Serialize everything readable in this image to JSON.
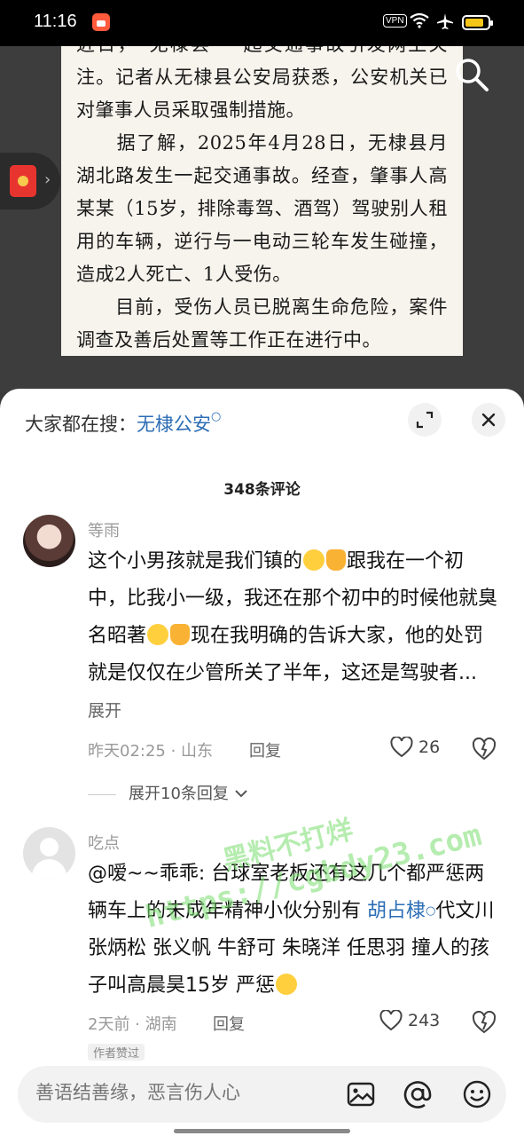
{
  "status_bar": {
    "time": "11:16",
    "vpn": "VPN"
  },
  "article": {
    "paragraphs": [
      "近日，“无棣县”一起交通事故引发网上关注。记者从无棣县公安局获悉，公安机关已对肇事人员采取强制措施。",
      "　　据了解，2025年4月28日，无棣县月湖北路发生一起交通事故。经查，肇事人高某某（15岁，排除毒驾、酒驾）驾驶别人租用的车辆，逆行与一电动三轮车发生碰撞，造成2人死亡、1人受伤。",
      "　　目前，受伤人员已脱离生命危险，案件调查及善后处置等工作正在进行中。"
    ]
  },
  "sheet": {
    "hot_search_label": "大家都在搜：",
    "hot_search_keyword": "无棣公安",
    "comment_count": "348条评论",
    "comments": [
      {
        "user": "等雨",
        "text_parts": [
          "这个小男孩就是我们镇的",
          "跟我在一个初中，比我小一级，我还在那个初中的时候他就臭名昭著",
          "现在我明确的告诉大家，他的处罚就是仅仅在少管所关了半年，这还是驾驶者..."
        ],
        "more": "展开",
        "time_loc": "昨天02:25 · 山东",
        "reply": "回复",
        "likes": "26",
        "expand_replies": "展开10条回复"
      },
      {
        "user": "吃点",
        "text_parts": [
          "@嗳~~乖乖: 台球室老板还有这几个都严惩两辆车上的未成年精神小伙分别有 ",
          "代文川 张炳松 张义帆 牛舒可 朱晓洋 任思羽 撞人的孩子叫高晨昊15岁 严惩"
        ],
        "link": "胡占棣",
        "time_loc": "2天前 · 湖南",
        "reply": "回复",
        "likes": "243",
        "author_tag": "作者赞过"
      }
    ]
  },
  "input": {
    "placeholder": "善语结善缘，恶言伤人心"
  },
  "watermark": {
    "url": "https://cgbdy23.com",
    "text": "黑料不打烊"
  },
  "colors": {
    "link": "#2c6db5",
    "sheet_bg": "#ffffff",
    "backdrop": "#3d3d3d"
  },
  "icons": [
    "search-icon",
    "red-packet-icon",
    "expand-icon",
    "close-icon",
    "heart-icon",
    "dislike-icon",
    "image-icon",
    "at-icon",
    "emoji-icon"
  ]
}
